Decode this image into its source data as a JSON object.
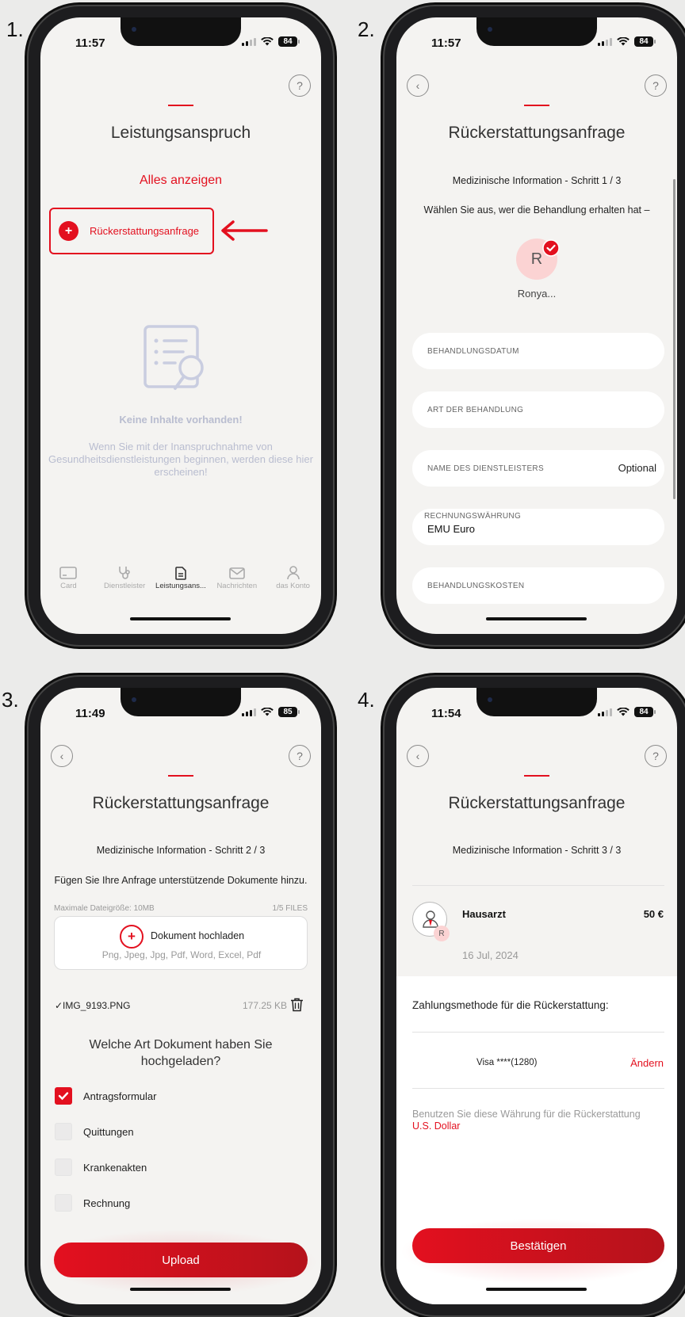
{
  "steps": [
    "1.",
    "2.",
    "3.",
    "4."
  ],
  "colors": {
    "accent": "#e3101f",
    "background": "#f4f3f1"
  },
  "phone1": {
    "time": "11:57",
    "battery": "84",
    "help": "?",
    "title": "Leistungsanspruch",
    "show_all": "Alles anzeigen",
    "refund_button": "Rückerstattungsanfrage",
    "empty_title": "Keine Inhalte vorhanden!",
    "empty_text": "Wenn Sie mit der Inanspruchnahme von Gesundheitsdienstleistungen beginnen, werden diese hier erscheinen!",
    "tabs": [
      {
        "label": "Card",
        "icon": "card-icon"
      },
      {
        "label": "Dienstleister",
        "icon": "stethoscope-icon"
      },
      {
        "label": "Leistungsans...",
        "icon": "document-icon"
      },
      {
        "label": "Nachrichten",
        "icon": "mail-icon"
      },
      {
        "label": "das Konto",
        "icon": "person-icon"
      }
    ]
  },
  "phone2": {
    "time": "11:57",
    "battery": "84",
    "back": "‹",
    "help": "?",
    "title": "Rückerstattungsanfrage",
    "step": "Medizinische Information - Schritt 1 / 3",
    "question": "Wählen Sie aus, wer die Behandlung erhalten hat –",
    "avatar_initial": "R",
    "avatar_name": "Ronya...",
    "fields": {
      "date": "BEHANDLUNGSDATUM",
      "type": "ART DER BEHANDLUNG",
      "provider": "NAME DES DIENSTLEISTERS",
      "provider_hint": "Optional",
      "currency_label": "RECHNUNGSWÄHRUNG",
      "currency_value": "EMU Euro",
      "cost": "BEHANDLUNGSKOSTEN"
    }
  },
  "phone3": {
    "time": "11:49",
    "battery": "85",
    "back": "‹",
    "help": "?",
    "title": "Rückerstattungsanfrage",
    "step": "Medizinische Information - Schritt 2 / 3",
    "instruction": "Fügen Sie Ihre Anfrage unterstützende Dokumente hinzu.",
    "max_size": "Maximale Dateigröße: 10MB",
    "files_count": "1/5 FILES",
    "upload_label": "Dokument hochladen",
    "upload_types": "Png, Jpeg, Jpg, Pdf, Word, Excel, Pdf",
    "file_name": "✓IMG_9193.PNG",
    "file_size": "177.25 KB",
    "doc_question": "Welche Art Dokument haben Sie hochgeladen?",
    "options": [
      {
        "label": "Antragsformular",
        "checked": true
      },
      {
        "label": "Quittungen",
        "checked": false
      },
      {
        "label": "Krankenakten",
        "checked": false
      },
      {
        "label": "Rechnung",
        "checked": false
      }
    ],
    "submit": "Upload"
  },
  "phone4": {
    "time": "11:54",
    "battery": "84",
    "back": "‹",
    "help": "?",
    "title": "Rückerstattungsanfrage",
    "step": "Medizinische Information - Schritt 3 / 3",
    "provider": "Hausarzt",
    "amount": "50 €",
    "badge": "R",
    "date": "16 Jul, 2024",
    "payment_label": "Zahlungsmethode für die Rückerstattung:",
    "card": "Visa ****(1280)",
    "change": "Ändern",
    "currency_note": "Benutzen Sie diese Währung für die Rückerstattung",
    "currency": "U.S. Dollar",
    "confirm": "Bestätigen"
  }
}
